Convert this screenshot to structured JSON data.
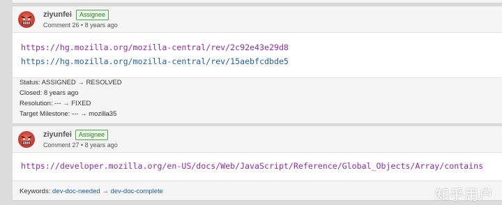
{
  "comments": [
    {
      "author": "ziyunfei",
      "badge": "Assignee",
      "meta": "Comment 26 • 8 years ago",
      "links": [
        {
          "text": "https://hg.mozilla.org/mozilla-central/rev/2c92e43e29d8"
        },
        {
          "text": "https://hg.mozilla.org/mozilla-central/rev/15aebfcdbde5"
        }
      ],
      "changes": {
        "status": "Status: ASSIGNED → RESOLVED",
        "closed": "Closed: 8 years ago",
        "resolution": "Resolution: --- → FIXED",
        "milestone": "Target Milestone: --- → mozilla35"
      }
    },
    {
      "author": "ziyunfei",
      "badge": "Assignee",
      "meta": "Comment 27 • 8 years ago",
      "links": [
        {
          "text": "https://developer.mozilla.org/en-US/docs/Web/JavaScript/Reference/Global_Objects/Array/contains"
        }
      ],
      "changes": {
        "keywords_label": "Keywords:",
        "keyword_old": "dev-doc-needed",
        "arrow": "→",
        "keyword_new": "dev-doc-complete"
      }
    }
  ],
  "watermark": "知乎用户",
  "colors": {
    "visited_link": "#8e2ba6",
    "unvisited_link": "#1f5fa6",
    "badge_green": "#3a7d34",
    "avatar": "#c93c31"
  },
  "icons": {
    "avatar": "angry-face-avatar-icon"
  }
}
